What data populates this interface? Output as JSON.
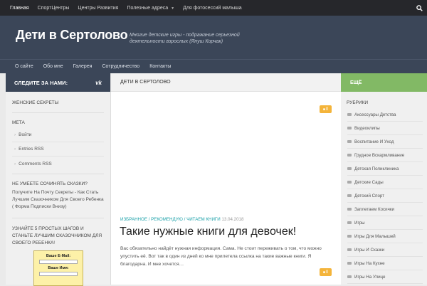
{
  "topnav": {
    "items": [
      "Главная",
      "СпортЦентры",
      "Центры Развития",
      "Полезные адреса",
      "Для фотосессий малыша"
    ],
    "dropdown_item_index": 3
  },
  "header": {
    "title": "Дети в Сертолово",
    "tagline": "Многие детские игры - подражание серьезной деятельности взрослых (Януш Корчак)"
  },
  "mainnav": {
    "items": [
      "О сайте",
      "Обо мне",
      "Галерея",
      "Сотрудничество",
      "Контакты"
    ]
  },
  "left": {
    "follow": "СЛЕДИТЕ ЗА НАМИ:",
    "vk": "vk",
    "w1": "ЖЕНСКИЕ СЕКРЕТЫ",
    "meta_title": "МЕТА",
    "meta": [
      "Войти",
      "Entries RSS",
      "Comments RSS"
    ],
    "tales_title": "НЕ УМЕЕТЕ СОЧИНЯТЬ СКАЗКИ?",
    "tales_text": "Получите На Почту Секреты - Как Стать Лучшим Сказочником Для Своего Ребенка ( Форма Подписки Внизу)",
    "steps_title": "УЗНАЙТЕ 5 ПРОСТЫХ ШАГОВ И СТАНЬТЕ ЛУЧШИМ СКАЗОЧНИКОМ ДЛЯ СВОЕГО РЕБЕНКА!",
    "email_label": "Ваше E-Mail:",
    "name_label": "Ваше Имя:"
  },
  "main": {
    "head": "ДЕТИ В СЕРТОЛОВО",
    "badge1": "0",
    "cats": [
      "ИЗБРАННОЕ",
      "РЕКОМЕНДУЮ",
      "ЧИТАЕМ КНИГИ"
    ],
    "date": "13.04.2018",
    "post_title": "Такие нужные книги для девочек!",
    "excerpt": "Вас обязательно найдёт нужная информация. Сама. Не стоит переживать о том, что можно упустить её. Вот так в один из дней ко мне прилетела ссылка на такие важные книги. Я благодарна. И мне хочется…",
    "badge2": "0"
  },
  "right": {
    "head": "ЕЩЁ",
    "rub_title": "РУБРИКИ",
    "rubrics": [
      "Аксессуары Детства",
      "Видеоклипы",
      "Воспитание И Уход",
      "Грудное Вскармливание",
      "Детская Поликлиника",
      "Детские Сады",
      "Детский Спорт",
      "Заплетаем Косички",
      "Игры",
      "Игры Для Малышей",
      "Игры И Сказки",
      "Игры На Кухне",
      "Игры На Улице"
    ]
  },
  "colors": {
    "topbar": "#26272b",
    "header": "#3b4658",
    "accent_green": "#82b965",
    "badge": "#f4b43a",
    "link": "#1aa0a8"
  },
  "icons": {
    "search": "search-icon",
    "vk": "vk-icon",
    "comment": "comment-icon",
    "folder": "folder-icon",
    "arrow": "arrow-icon"
  }
}
